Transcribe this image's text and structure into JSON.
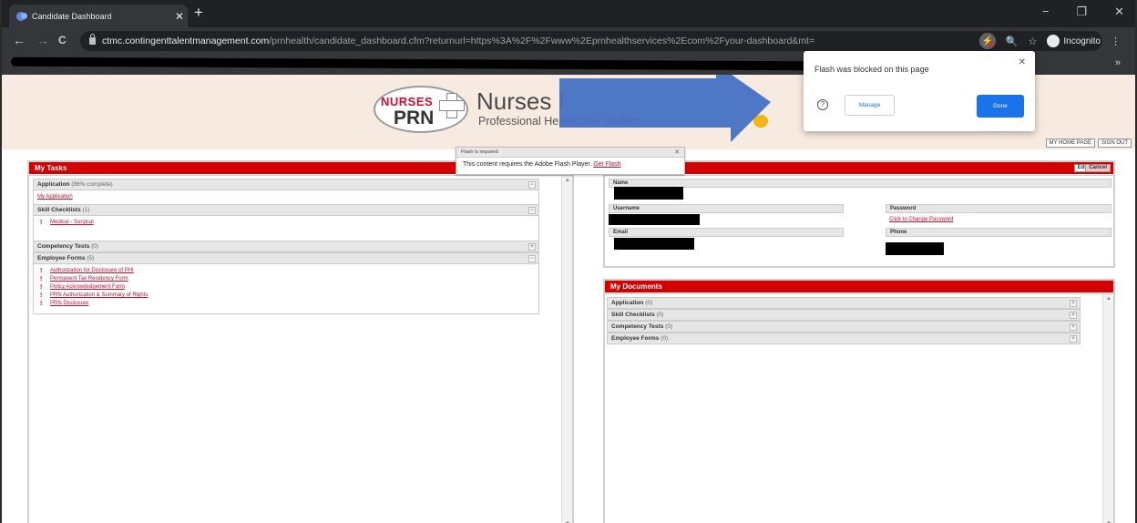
{
  "browser": {
    "tab_title": "Candidate Dashboard",
    "tab_close": "✕",
    "new_tab": "+",
    "win_minimize": "−",
    "win_restore": "❐",
    "win_close": "✕",
    "back": "←",
    "forward": "→",
    "reload": "C",
    "url_host": "ctmc.contingenttalentmanagement.com",
    "url_path": "/prnhealth/candidate_dashboard.cfm?returnurl=https%3A%2F%2Fwww%2Eprnhealthservices%2Ecom%2Fyour-dashboard&mt=",
    "zoom_icon": "🔍",
    "star_icon": "☆",
    "incognito_label": "Incognito",
    "menu_icon": "⋮",
    "bookmarks_more": "»"
  },
  "header": {
    "logo_nurses": "NURSES",
    "logo_prn": "PRN",
    "brand_name": "Nurses I",
    "tagline": "Professional Healthcare Staffing",
    "links": [
      "MY HOME PAGE",
      "SIGN OUT"
    ]
  },
  "flash_bar": {
    "title": "Flash is required",
    "close": "✕",
    "message": "This content requires the Adobe Flash Player.",
    "link": "Get Flash"
  },
  "popup": {
    "title": "Flash was blocked on this page",
    "close": "✕",
    "help": "?",
    "manage": "Manage",
    "done": "Done"
  },
  "tasks": {
    "title": "My Tasks",
    "application_label": "Application",
    "application_count": "(86% complete)",
    "application_link": "My Application",
    "skill_label": "Skill Checklists",
    "skill_count": "(1)",
    "skill_items": [
      "Medical - Surgical"
    ],
    "competency_label": "Competency Tests",
    "competency_count": "(0)",
    "forms_label": "Employee Forms",
    "forms_count": "(5)",
    "forms_items": [
      "Authorization for Disclosure of PHI",
      "Permanent Tax Residency Form",
      "Policy Acknowledgement Form",
      "PRN Authorization & Summary of Rights",
      "PRN Disclosure"
    ]
  },
  "account": {
    "edit_btn": "Edit",
    "cancel_btn": "Cancel",
    "name_label": "Name",
    "username_label": "Username",
    "password_label": "Password",
    "change_password": "Click to Change Password",
    "email_label": "Email",
    "phone_label": "Phone"
  },
  "documents": {
    "title": "My Documents",
    "sections": [
      {
        "label": "Application",
        "count": "(0)"
      },
      {
        "label": "Skill Checklists",
        "count": "(0)"
      },
      {
        "label": "Competency Tests",
        "count": "(0)"
      },
      {
        "label": "Employee Forms",
        "count": "(0)"
      }
    ]
  },
  "toggles": {
    "minus": "−",
    "plus": "+"
  },
  "scroll": {
    "up": "▲",
    "down": "▼"
  },
  "colors": {
    "header_red": "#d40000",
    "link_red": "#c8102e",
    "accent_blue": "#1a73e8",
    "arrow_blue": "#4472c4"
  }
}
